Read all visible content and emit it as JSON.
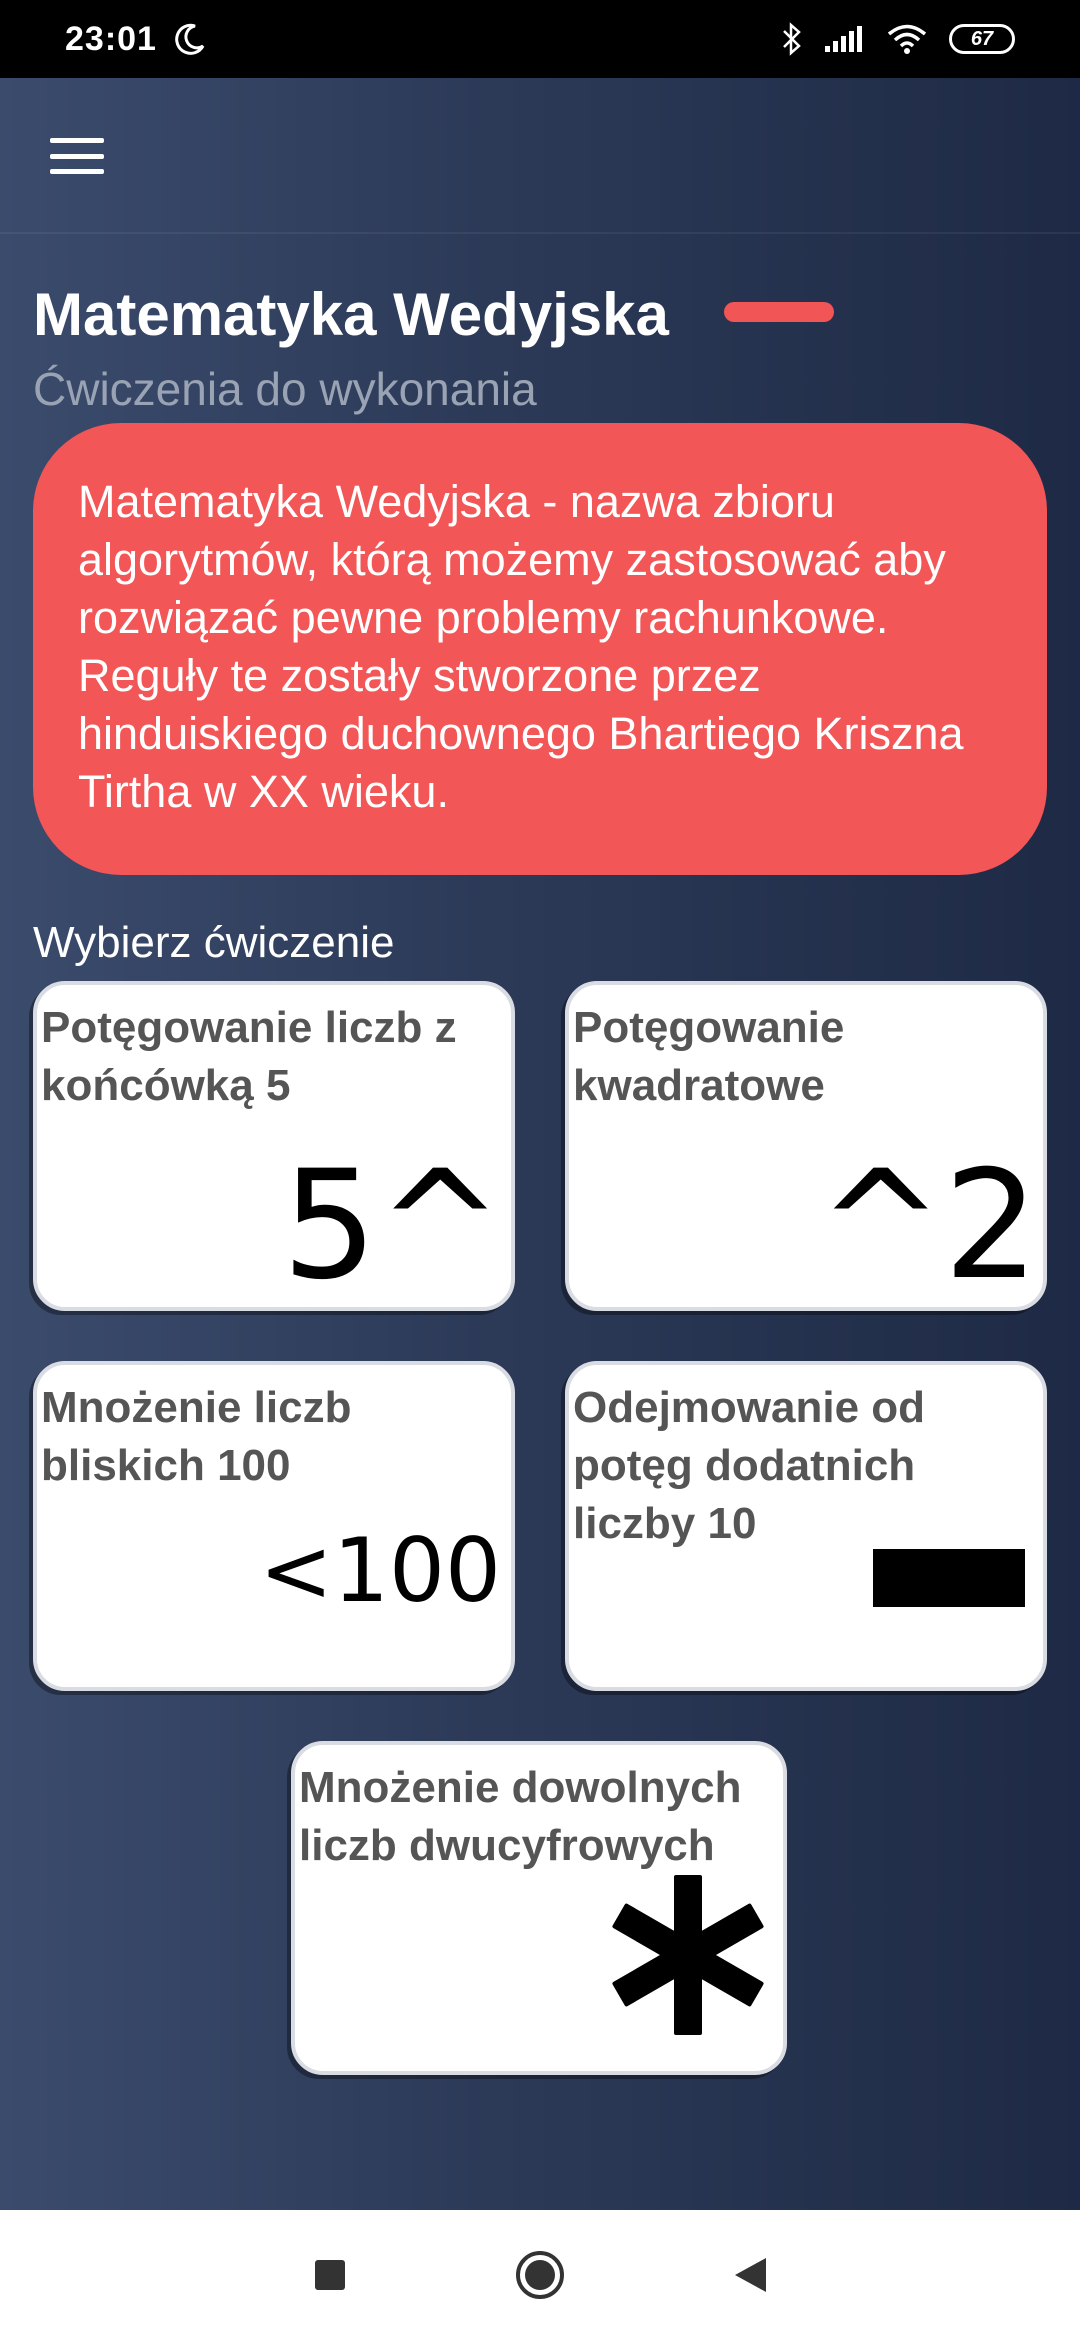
{
  "status_bar": {
    "time": "23:01",
    "battery": "67",
    "icons": [
      "moon-icon",
      "bluetooth-icon",
      "signal-icon",
      "wifi-icon",
      "battery-icon"
    ]
  },
  "app_bar": {
    "menu_icon": "hamburger-menu-icon"
  },
  "header": {
    "title": "Matematyka Wedyjska",
    "subtitle": "Ćwiczenia do wykonania",
    "accent_color": "#f25555"
  },
  "info_card": {
    "text": "Matematyka Wedyjska - nazwa zbioru algorytmów, którą możemy zastosować aby rozwiązać pewne problemy rachunkowe. Reguły te zostały stworzone przez hinduiskiego duchownego Bhartiego Kriszna Tirtha w XX wieku.",
    "background": "#f25656"
  },
  "exercises": {
    "label": "Wybierz ćwiczenie",
    "items": [
      {
        "label": "Potęgowanie liczb z końcówką 5",
        "symbol": "5^"
      },
      {
        "label": "Potęgowanie kwadratowe",
        "symbol": "^2"
      },
      {
        "label": "Mnożenie liczb bliskich 100",
        "symbol": "<100"
      },
      {
        "label": "Odejmowanie od potęg dodatnich liczby 10",
        "symbol": "minus-icon"
      },
      {
        "label": "Mnożenie dowolnych liczb dwucyfrowych",
        "symbol": "asterisk-icon"
      }
    ]
  },
  "nav_bar": {
    "buttons": [
      "recents-square-icon",
      "home-circle-icon",
      "back-triangle-icon"
    ]
  }
}
